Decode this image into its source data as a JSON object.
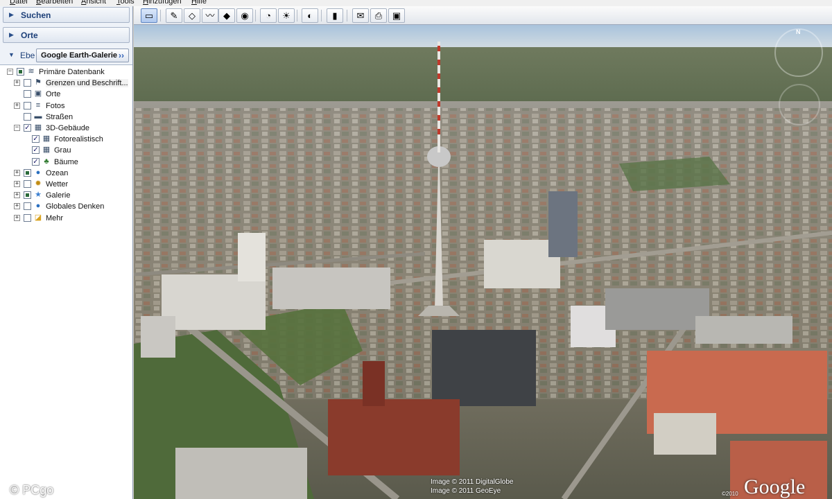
{
  "menu": [
    "Datei",
    "Bearbeiten",
    "Ansicht",
    "Tools",
    "Hinzufügen",
    "Hilfe"
  ],
  "sidebar": {
    "search_label": "Suchen",
    "places_label": "Orte",
    "layers_label": "Ebe",
    "gallery_button": "Google Earth-Galerie",
    "tree": [
      {
        "label": "Primäre Datenbank",
        "icon": "database-icon",
        "glyph": "≋",
        "expander": "minus",
        "checkbox": "partial",
        "level": 0
      },
      {
        "label": "Grenzen und Beschrift...",
        "icon": "borders-flag-icon",
        "glyph": "⚑",
        "expander": "plus",
        "checkbox": "off",
        "level": 1,
        "selected": true
      },
      {
        "label": "Orte",
        "icon": "places-icon",
        "glyph": "▣",
        "expander": "none",
        "checkbox": "off",
        "level": 1
      },
      {
        "label": "Fotos",
        "icon": "photos-icon",
        "glyph": "≡",
        "expander": "plus",
        "checkbox": "off",
        "level": 1
      },
      {
        "label": "Straßen",
        "icon": "roads-icon",
        "glyph": "▬",
        "expander": "none",
        "checkbox": "off",
        "level": 1
      },
      {
        "label": "3D-Gebäude",
        "icon": "buildings-3d-icon",
        "glyph": "▦",
        "expander": "minus",
        "checkbox": "on",
        "level": 1
      },
      {
        "label": "Fotorealistisch",
        "icon": "photorealistic-icon",
        "glyph": "▦",
        "expander": "none",
        "checkbox": "on",
        "level": 2
      },
      {
        "label": "Grau",
        "icon": "grey-buildings-icon",
        "glyph": "▦",
        "expander": "none",
        "checkbox": "on",
        "level": 2
      },
      {
        "label": "Bäume",
        "icon": "tree-icon",
        "glyph": "♣",
        "expander": "none",
        "checkbox": "on",
        "level": 2
      },
      {
        "label": "Ozean",
        "icon": "ocean-globe-icon",
        "glyph": "●",
        "expander": "plus",
        "checkbox": "partial",
        "level": 1
      },
      {
        "label": "Wetter",
        "icon": "weather-sun-icon",
        "glyph": "✹",
        "expander": "plus",
        "checkbox": "off",
        "level": 1
      },
      {
        "label": "Galerie",
        "icon": "gallery-star-icon",
        "glyph": "★",
        "expander": "plus",
        "checkbox": "partial",
        "level": 1
      },
      {
        "label": "Globales Denken",
        "icon": "global-awareness-icon",
        "glyph": "●",
        "expander": "plus",
        "checkbox": "off",
        "level": 1
      },
      {
        "label": "Mehr",
        "icon": "more-folder-icon",
        "glyph": "◪",
        "expander": "plus",
        "checkbox": "off",
        "level": 1
      }
    ]
  },
  "toolbar": [
    {
      "name": "sidebar-toggle-button",
      "glyph": "▭",
      "active": true
    },
    {
      "name": "add-placemark-button",
      "glyph": "✎"
    },
    {
      "name": "add-polygon-button",
      "glyph": "◇"
    },
    {
      "name": "add-path-button",
      "glyph": "〰"
    },
    {
      "name": "add-image-overlay-button",
      "glyph": "◆"
    },
    {
      "name": "record-tour-button",
      "glyph": "◉"
    },
    {
      "name": "historical-imagery-button",
      "glyph": "◔"
    },
    {
      "name": "sunlight-button",
      "glyph": "☀"
    },
    {
      "name": "planets-button",
      "glyph": "◐"
    },
    {
      "name": "ruler-button",
      "glyph": "▮"
    },
    {
      "name": "email-button",
      "glyph": "✉"
    },
    {
      "name": "print-button",
      "glyph": "⎙"
    },
    {
      "name": "save-image-button",
      "glyph": "▣"
    }
  ],
  "map": {
    "credit_1": "Image © 2011 DigitalGlobe",
    "credit_2": "Image © 2011 GeoEye",
    "logo": "Google",
    "copyright_year": "©2010",
    "north_label": "N"
  },
  "watermark": "© PCgo"
}
